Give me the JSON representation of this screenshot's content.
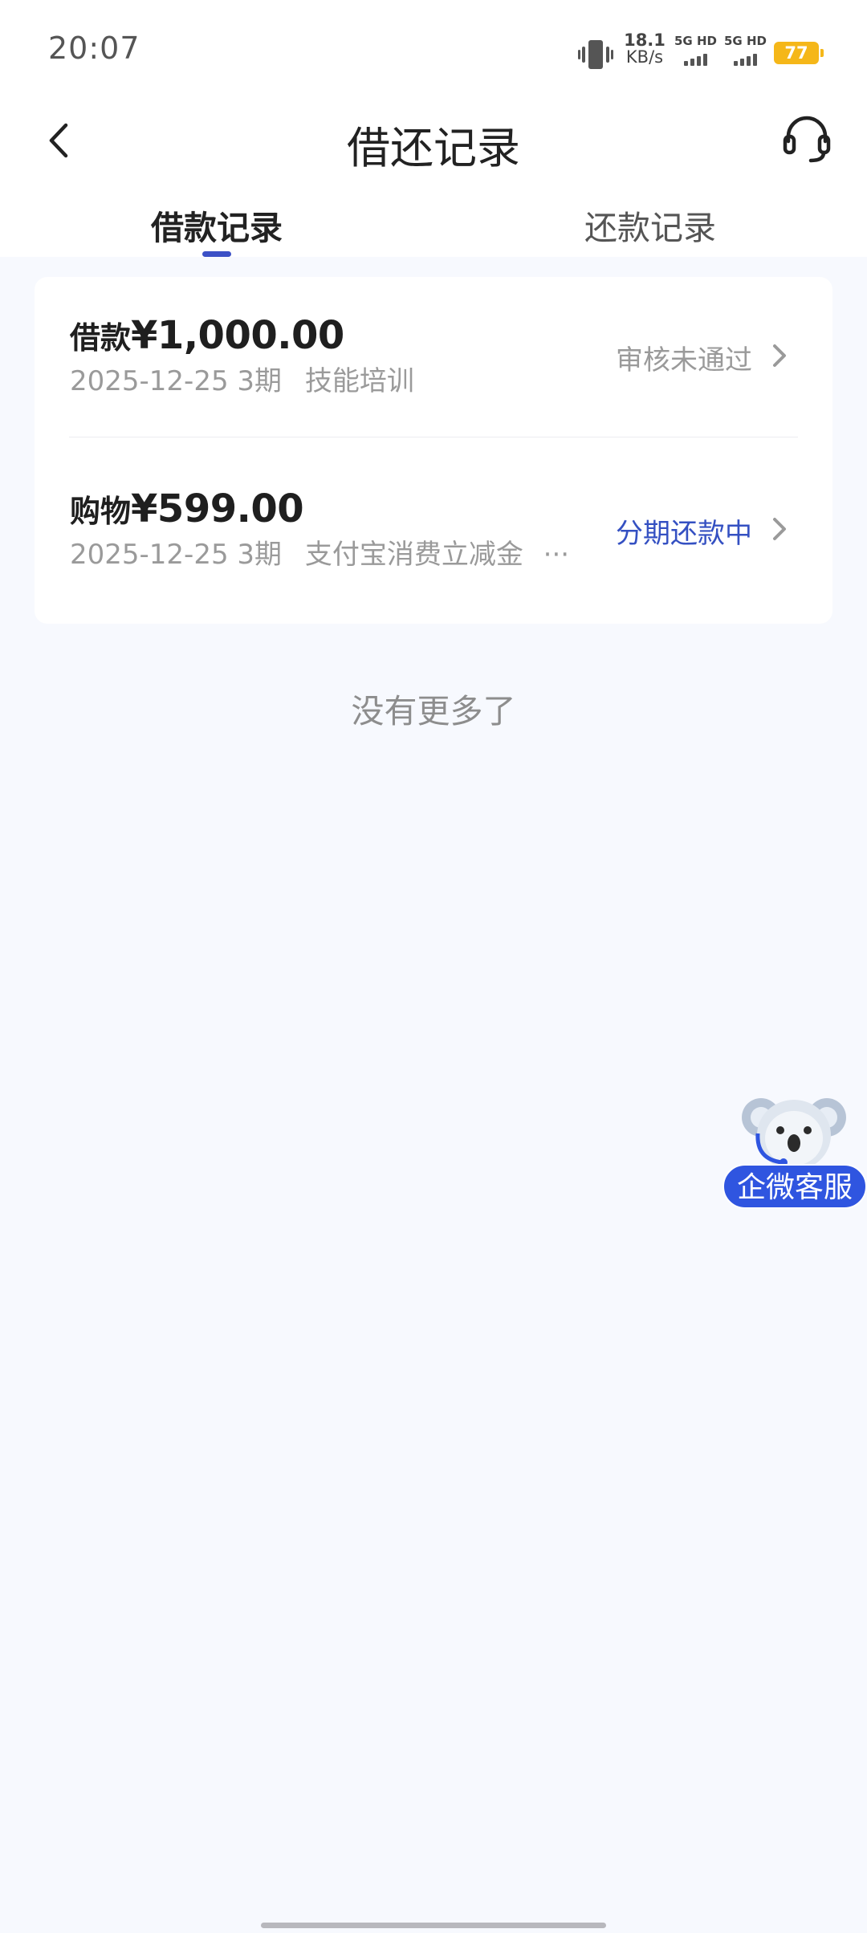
{
  "status_bar": {
    "time": "20:07",
    "net_speed_value": "18.1",
    "net_speed_unit": "KB/s",
    "sim1_label": "5G HD",
    "sim2_label": "5G HD",
    "battery": "77",
    "battery_color": "#f5b719"
  },
  "header": {
    "title": "借还记录",
    "back_icon": "chevron-left-icon",
    "service_icon": "headset-icon"
  },
  "tabs": [
    {
      "label": "借款记录",
      "active": true
    },
    {
      "label": "还款记录",
      "active": false
    }
  ],
  "records": [
    {
      "type_label": "借款",
      "amount": "¥1,000.00",
      "date": "2025-12-25",
      "period": "3期",
      "description": "技能培训",
      "status": "审核未通过",
      "status_color": "#9a9a9a"
    },
    {
      "type_label": "购物",
      "amount": "¥599.00",
      "date": "2025-12-25",
      "period": "3期",
      "description": "支付宝消费立减金",
      "truncation": "···",
      "status": "分期还款中",
      "status_color": "#3450c2"
    }
  ],
  "footer_text": "没有更多了",
  "floating_service": {
    "label": "企微客服",
    "icon": "koala-mascot-icon"
  },
  "accent_color": "#3b50c6"
}
